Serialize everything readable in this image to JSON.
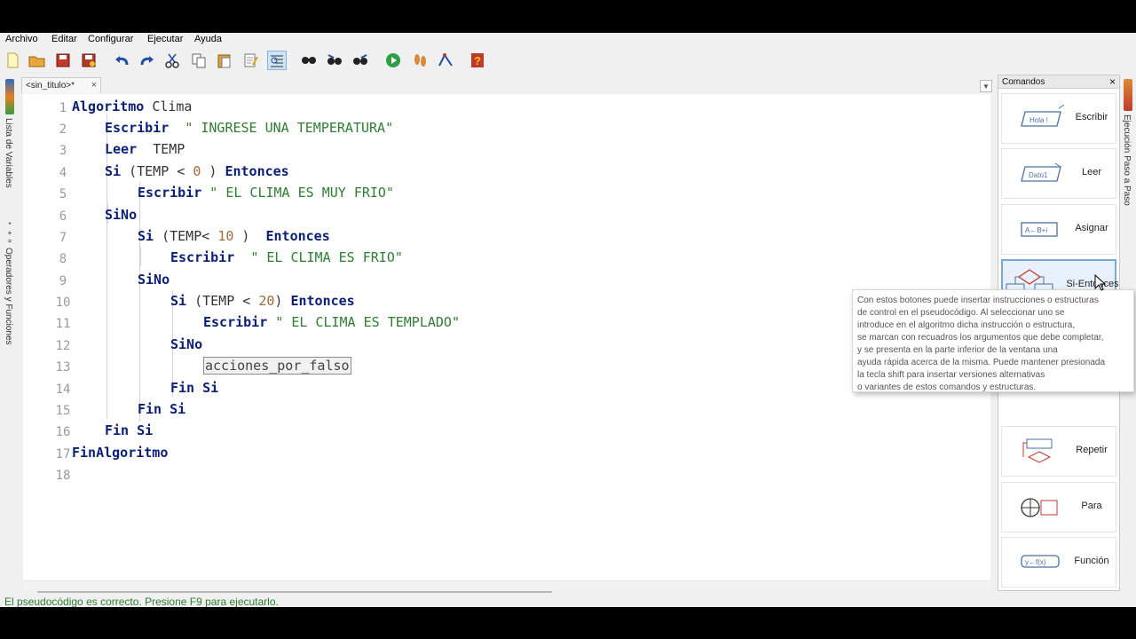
{
  "menu": [
    "Archivo",
    "Editar",
    "Configurar",
    "Ejecutar",
    "Ayuda"
  ],
  "tab": {
    "title": "<sin_titulo>*",
    "close": "×"
  },
  "left_strip": {
    "variables": "Lista de Variables",
    "operators": "Operadores y Funciones"
  },
  "right_strip": {
    "step": "Ejecución Paso a Paso"
  },
  "code": {
    "line_numbers": [
      "1",
      "2",
      "3",
      "4",
      "5",
      "6",
      "7",
      "8",
      "9",
      "10",
      "11",
      "12",
      "13",
      "14",
      "15",
      "16",
      "17",
      "18"
    ],
    "l1_kw": "Algoritmo",
    "l1_name": "Clima",
    "l2_kw": "Escribir",
    "l2_str": "\" INGRESE UNA TEMPERATURA\"",
    "l3_kw": "Leer",
    "l3_var": "TEMP",
    "l4_kw": "Si",
    "l4_a": "(TEMP <",
    "l4_num": "0",
    "l4_b": ")",
    "l4_kw2": "Entonces",
    "l5_kw": "Escribir",
    "l5_str": "\" EL CLIMA ES MUY FRIO\"",
    "l6_kw": "SiNo",
    "l7_kw": "Si",
    "l7_a": "(TEMP<",
    "l7_num": "10",
    "l7_b": ")",
    "l7_kw2": "Entonces",
    "l8_kw": "Escribir",
    "l8_str": "\" EL CLIMA ES FRIO\"",
    "l9_kw": "SiNo",
    "l10_kw": "Si",
    "l10_a": "(TEMP <",
    "l10_num": "20",
    "l10_b": ")",
    "l10_kw2": "Entonces",
    "l11_kw": "Escribir",
    "l11_str": "\" EL CLIMA ES TEMPLADO\"",
    "l12_kw": "SiNo",
    "l13_placeholder": "acciones_por_falso",
    "l14_kw": "Fin Si",
    "l15_kw": "Fin Si",
    "l16_kw": "Fin Si",
    "l17_kw": "FinAlgoritmo"
  },
  "status": "El pseudocódigo es correcto. Presione F9 para ejecutarlo.",
  "panel": {
    "title": "Comandos",
    "close": "×",
    "commands": [
      {
        "label": "Escribir",
        "icon_text": "Hola !"
      },
      {
        "label": "Leer",
        "icon_text": "Dato1"
      },
      {
        "label": "Asignar",
        "icon_text": "A←B+i"
      },
      {
        "label": "Si-Entonces",
        "icon_text": ""
      },
      {
        "label": "Repetir",
        "icon_text": ""
      },
      {
        "label": "Para",
        "icon_text": ""
      },
      {
        "label": "Función",
        "icon_text": "y←f(x)"
      }
    ]
  },
  "tooltip": [
    "Con estos botones puede insertar instrucciones o estructuras",
    "de control en el pseudocódigo. Al seleccionar uno se",
    "introduce en el algoritmo dicha instrucción o estructura,",
    "se marcan con recuadros los argumentos que debe completar,",
    "y se presenta en la parte inferior de la ventana una",
    "ayuda rápida acerca de la misma. Puede mantener presionada",
    "la tecla shift para insertar versiones alternativas",
    "o variantes de estos comandos y estructuras."
  ]
}
